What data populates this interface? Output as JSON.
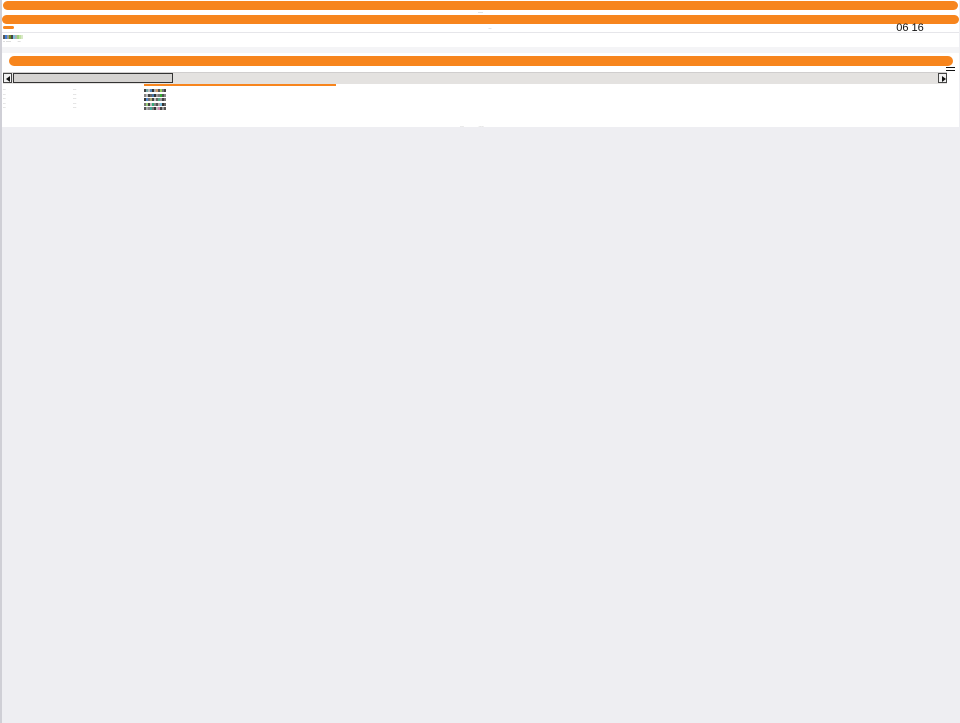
{
  "header": {
    "title": "-----",
    "subtitle": "---",
    "time": "06 16"
  },
  "meta": {
    "left": "-- -----",
    "right": "---"
  },
  "swatch_colors": [
    "#555555",
    "#3a7bd5",
    "#999999",
    "#6b8e23",
    "#444444",
    "#7cc0d8",
    "#b0b0b0",
    "#9bd07a",
    "#c0e0a0",
    "#d8e8c8"
  ],
  "rows": [
    {
      "c1": "----",
      "c2": "-----",
      "swatches": [
        "#444",
        "#7aa",
        "#bbb",
        "#58b",
        "#333",
        "#aaa",
        "#c96",
        "#555",
        "#9c6",
        "#777",
        "#444"
      ]
    },
    {
      "c1": "----",
      "c2": "-----",
      "swatches": [
        "#888",
        "#bbb",
        "#444",
        "#666",
        "#47a",
        "#333",
        "#999",
        "#777",
        "#3a3",
        "#555",
        "#888"
      ]
    },
    {
      "c1": "----",
      "c2": "-----",
      "swatches": [
        "#333",
        "#58c",
        "#777",
        "#aa7",
        "#444",
        "#bbb",
        "#666",
        "#5a8",
        "#999",
        "#444",
        "#777"
      ]
    },
    {
      "c1": "----",
      "c2": "-----",
      "swatches": [
        "#777",
        "#9c7",
        "#444",
        "#bbb",
        "#3a7",
        "#888",
        "#555",
        "#aaa",
        "#7bd",
        "#333",
        "#666"
      ]
    },
    {
      "c1": "----",
      "c2": "-----",
      "swatches": [
        "#555",
        "#aaa",
        "#888",
        "#4a9",
        "#777",
        "#333",
        "#bbb",
        "#c8a",
        "#444",
        "#999",
        "#555"
      ]
    }
  ],
  "progress": {
    "percent": 100
  },
  "footer": {
    "left": "------",
    "right": "--------"
  },
  "colors": {
    "accent": "#f7851d",
    "background": "#eeeef2"
  }
}
